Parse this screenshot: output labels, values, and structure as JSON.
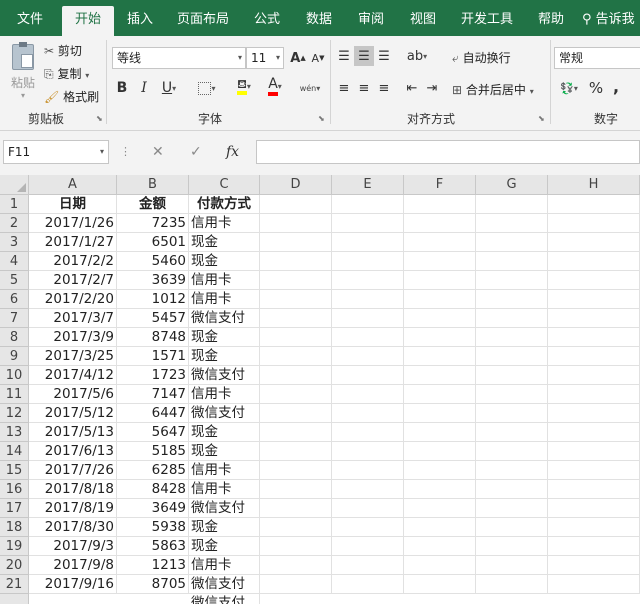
{
  "ribbon_tabs": [
    "文件",
    "开始",
    "插入",
    "页面布局",
    "公式",
    "数据",
    "审阅",
    "视图",
    "开发工具",
    "帮助",
    "告诉我"
  ],
  "active_tab": "开始",
  "clipboard": {
    "paste": "粘贴",
    "cut": "剪切",
    "copy": "复制",
    "format_painter": "格式刷",
    "group": "剪贴板"
  },
  "font": {
    "name": "等线",
    "size": "11",
    "grow": "A",
    "shrink": "A",
    "bold": "B",
    "italic": "I",
    "underline": "U",
    "font_color_letter": "A",
    "phonetic": "wén",
    "group": "字体",
    "fill_color": "#FFFF00",
    "text_color": "#FF0000"
  },
  "alignment": {
    "wrap_text": "自动换行",
    "merge_center": "合并后居中",
    "group": "对齐方式"
  },
  "number": {
    "format": "常规",
    "percent": "%",
    "comma": ",",
    "group": "数字"
  },
  "formula_bar": {
    "name_box": "F11",
    "cancel": "✕",
    "enter": "✓",
    "fx": "fx",
    "content": ""
  },
  "columns": [
    "A",
    "B",
    "C",
    "D",
    "E",
    "F",
    "G",
    "H"
  ],
  "header_row": {
    "row": "1",
    "date": "日期",
    "amount": "金额",
    "payment": "付款方式"
  },
  "rows": [
    {
      "row": "2",
      "date": "2017/1/26",
      "amount": "7235",
      "payment": "信用卡"
    },
    {
      "row": "3",
      "date": "2017/1/27",
      "amount": "6501",
      "payment": "现金"
    },
    {
      "row": "4",
      "date": "2017/2/2",
      "amount": "5460",
      "payment": "现金"
    },
    {
      "row": "5",
      "date": "2017/2/7",
      "amount": "3639",
      "payment": "信用卡"
    },
    {
      "row": "6",
      "date": "2017/2/20",
      "amount": "1012",
      "payment": "信用卡"
    },
    {
      "row": "7",
      "date": "2017/3/7",
      "amount": "5457",
      "payment": "微信支付"
    },
    {
      "row": "8",
      "date": "2017/3/9",
      "amount": "8748",
      "payment": "现金"
    },
    {
      "row": "9",
      "date": "2017/3/25",
      "amount": "1571",
      "payment": "现金"
    },
    {
      "row": "10",
      "date": "2017/4/12",
      "amount": "1723",
      "payment": "微信支付"
    },
    {
      "row": "11",
      "date": "2017/5/6",
      "amount": "7147",
      "payment": "信用卡"
    },
    {
      "row": "12",
      "date": "2017/5/12",
      "amount": "6447",
      "payment": "微信支付"
    },
    {
      "row": "13",
      "date": "2017/5/13",
      "amount": "5647",
      "payment": "现金"
    },
    {
      "row": "14",
      "date": "2017/6/13",
      "amount": "5185",
      "payment": "现金"
    },
    {
      "row": "15",
      "date": "2017/7/26",
      "amount": "6285",
      "payment": "信用卡"
    },
    {
      "row": "16",
      "date": "2017/8/18",
      "amount": "8428",
      "payment": "信用卡"
    },
    {
      "row": "17",
      "date": "2017/8/19",
      "amount": "3649",
      "payment": "微信支付"
    },
    {
      "row": "18",
      "date": "2017/8/30",
      "amount": "5938",
      "payment": "现金"
    },
    {
      "row": "19",
      "date": "2017/9/3",
      "amount": "5863",
      "payment": "现金"
    },
    {
      "row": "20",
      "date": "2017/9/8",
      "amount": "1213",
      "payment": "信用卡"
    },
    {
      "row": "21",
      "date": "2017/9/16",
      "amount": "8705",
      "payment": "微信支付"
    }
  ],
  "partial_row": {
    "payment": "微信支付"
  },
  "theme": {
    "accent": "#217346"
  }
}
